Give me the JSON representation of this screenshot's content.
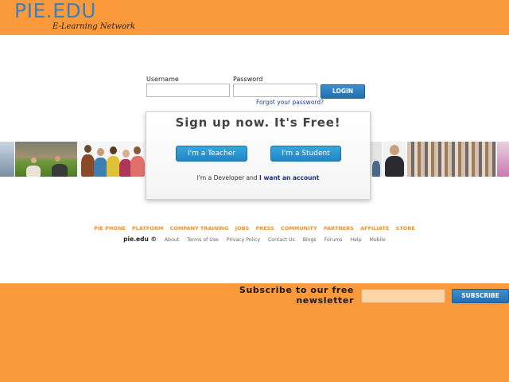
{
  "header": {
    "logo_text": "PIE.EDU",
    "tagline": "E-Learning Network",
    "background": "#fa9a3c",
    "logo_color": "#3d7fb8"
  },
  "login": {
    "username_label": "Username",
    "password_label": "Password",
    "username_value": "",
    "password_value": "",
    "login_button": "LOGIN",
    "forgot_link": "Forgot your password?"
  },
  "signup": {
    "title": "Sign up now. It's Free!",
    "teacher_button": "I'm a Teacher",
    "student_button": "I'm a Student",
    "developer_prefix": "I'm a Developer and",
    "developer_link": "I want an account"
  },
  "footer": {
    "nav": [
      "PIE PHONE",
      "PLATFORM",
      "COMPANY TRAINING",
      "JOBS",
      "PRESS",
      "COMMUNITY",
      "PARTNERS",
      "AFFILIATE",
      "STORE"
    ],
    "copyright": "pie.edu ©",
    "links": [
      "About",
      "Terms of Use",
      "Privacy Policy",
      "Contact Us",
      "Blogs",
      "Forums",
      "Help",
      "Mobile"
    ]
  },
  "newsletter": {
    "text": "Subscribe to our free newsletter",
    "input_value": "",
    "button": "SUBSCRIBE"
  },
  "colors": {
    "accent_orange": "#fa9a3c",
    "button_blue": "#236fb0",
    "link_blue": "#1c3f95"
  }
}
